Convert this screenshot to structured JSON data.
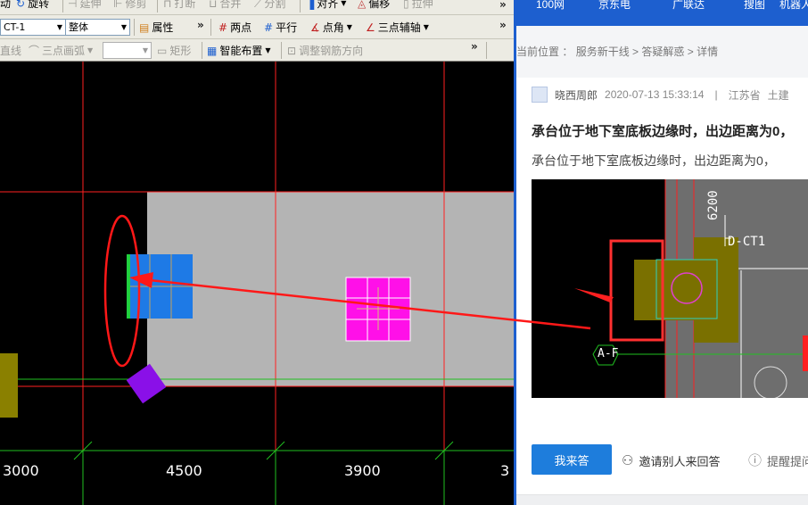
{
  "cad": {
    "toolbar1": {
      "items": [
        {
          "label": "动",
          "disabled": false
        },
        {
          "label": "旋转",
          "disabled": false
        },
        {
          "label": "延伸",
          "disabled": true
        },
        {
          "label": "修剪",
          "disabled": true
        },
        {
          "label": "打断",
          "disabled": true
        },
        {
          "label": "合并",
          "disabled": true
        },
        {
          "label": "分割",
          "disabled": true
        },
        {
          "label": "对齐",
          "disabled": false
        },
        {
          "label": "偏移",
          "disabled": false
        },
        {
          "label": "拉伸",
          "disabled": true
        }
      ]
    },
    "toolbar2": {
      "component_select": "CT-1",
      "mode_select": "整体",
      "property_label": "属性",
      "two_point_label": "两点",
      "parallel_label": "平行",
      "point_angle_label": "点角",
      "three_point_axis_label": "三点辅轴"
    },
    "toolbar3": {
      "line_label": "直线",
      "three_point_arc_label": "三点画弧",
      "rect_label": "矩形",
      "smart_layout_label": "智能布置",
      "adjust_rebar_label": "调整钢筋方向"
    },
    "dimensions": [
      "3000",
      "4500",
      "3900",
      "3"
    ],
    "colors": {
      "grid_red": "#ff2020",
      "grid_green": "#20c020",
      "slab": "#b4b4b4",
      "cap_blue": "#1e7ae6",
      "cap_magenta": "#ff10e8",
      "olive": "#8a8000",
      "purple": "#8a10e8"
    }
  },
  "web": {
    "header_tabs": [
      "100网",
      "京东电",
      "广联达",
      "搜图",
      "机器人"
    ],
    "breadcrumb": {
      "prefix": "当前位置 ：",
      "items": [
        "服务新干线",
        "答疑解惑",
        "详情"
      ]
    },
    "author": "晓西周郎",
    "datetime": "2020-07-13 15:33:14",
    "location": "江苏省",
    "category": "土建",
    "question_title": "承台位于地下室底板边缘时，出边距离为0，",
    "question_desc": "承台位于地下室底板边缘时，出边距离为0，",
    "thumbnail": {
      "dim_label": "6200",
      "component_label": "D-CT1",
      "axis_label": "A-F"
    },
    "answer_button": "我来答",
    "invite_label": "邀请别人来回答",
    "remind_label": "提醒提问"
  }
}
